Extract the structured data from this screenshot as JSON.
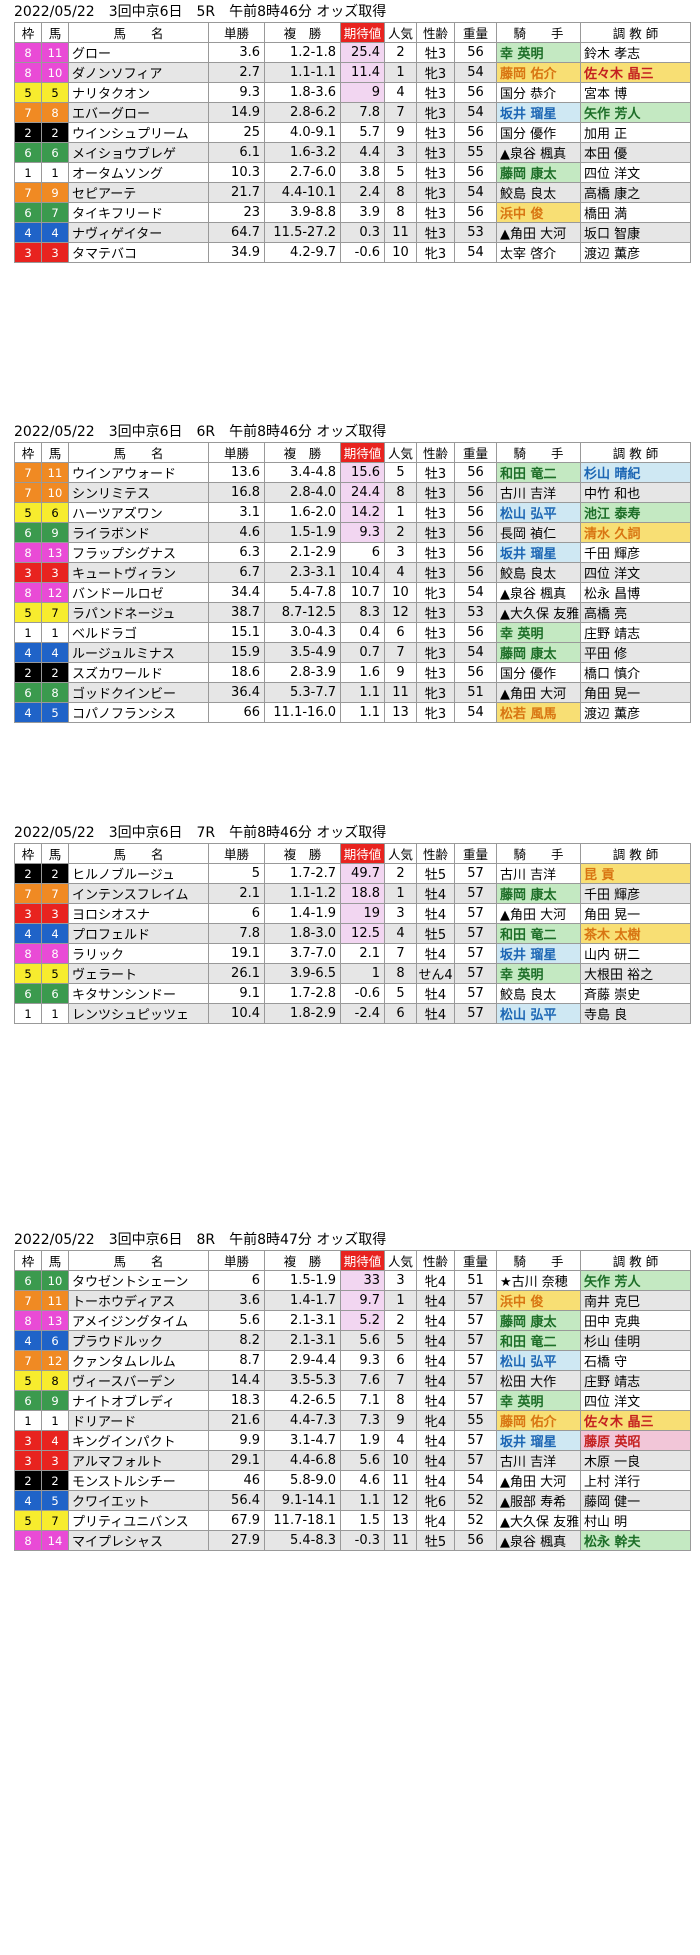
{
  "headers": {
    "waku": "枠",
    "uma": "馬",
    "name": "馬　　名",
    "tansho": "単勝",
    "fukusho": "複　勝",
    "expect": "期待値",
    "ninki": "人気",
    "seirei": "性齢",
    "juryo": "重量",
    "jockey": "騎　　手",
    "trainer": "調 教 師"
  },
  "races": [
    {
      "title": "2022/05/22　3回中京6日　5R　午前8時46分 オッズ取得",
      "rows": [
        [
          "8",
          "11",
          "グロー",
          "3.6",
          "1.2-1.8",
          "25.4",
          "2",
          "牡3",
          "56",
          "幸 英明",
          "鈴木 孝志"
        ],
        [
          "8",
          "10",
          "ダノンソフィア",
          "2.7",
          "1.1-1.1",
          "11.4",
          "1",
          "牝3",
          "54",
          "藤岡 佑介",
          "佐々木 晶三"
        ],
        [
          "5",
          "5",
          "ナリタクオン",
          "9.3",
          "1.8-3.6",
          "9",
          "4",
          "牡3",
          "56",
          "国分 恭介",
          "宮本 博"
        ],
        [
          "7",
          "8",
          "エバーグロー",
          "14.9",
          "2.8-6.2",
          "7.8",
          "7",
          "牝3",
          "54",
          "坂井 瑠星",
          "矢作 芳人"
        ],
        [
          "2",
          "2",
          "ウインシュプリーム",
          "25",
          "4.0-9.1",
          "5.7",
          "9",
          "牡3",
          "56",
          "国分 優作",
          "加用 正"
        ],
        [
          "6",
          "6",
          "メイショウブレゲ",
          "6.1",
          "1.6-3.2",
          "4.4",
          "3",
          "牡3",
          "55",
          "▲泉谷 楓真",
          "本田 優"
        ],
        [
          "1",
          "1",
          "オータムソング",
          "10.3",
          "2.7-6.0",
          "3.8",
          "5",
          "牡3",
          "56",
          "藤岡 康太",
          "四位 洋文"
        ],
        [
          "7",
          "9",
          "セピアーテ",
          "21.7",
          "4.4-10.1",
          "2.4",
          "8",
          "牝3",
          "54",
          "鮫島 良太",
          "高橋 康之"
        ],
        [
          "6",
          "7",
          "タイキフリード",
          "23",
          "3.9-8.8",
          "3.9",
          "8",
          "牡3",
          "56",
          "浜中 俊",
          "橋田 満"
        ],
        [
          "4",
          "4",
          "ナヴィゲイター",
          "64.7",
          "11.5-27.2",
          "0.3",
          "11",
          "牡3",
          "53",
          "▲角田 大河",
          "坂口 智康"
        ],
        [
          "3",
          "3",
          "タマテバコ",
          "34.9",
          "4.2-9.7",
          "-0.6",
          "10",
          "牝3",
          "54",
          "太宰 啓介",
          "渡辺 薫彦"
        ]
      ]
    },
    {
      "title": "2022/05/22　3回中京6日　6R　午前8時46分 オッズ取得",
      "rows": [
        [
          "7",
          "11",
          "ウインアウォード",
          "13.6",
          "3.4-4.8",
          "15.6",
          "5",
          "牡3",
          "56",
          "和田 竜二",
          "杉山 晴紀"
        ],
        [
          "7",
          "10",
          "シンリミテス",
          "16.8",
          "2.8-4.0",
          "24.4",
          "8",
          "牡3",
          "56",
          "古川 吉洋",
          "中竹 和也"
        ],
        [
          "5",
          "6",
          "ハーツアズワン",
          "3.1",
          "1.6-2.0",
          "14.2",
          "1",
          "牡3",
          "56",
          "松山 弘平",
          "池江 泰寿"
        ],
        [
          "6",
          "9",
          "ライラボンド",
          "4.6",
          "1.5-1.9",
          "9.3",
          "2",
          "牡3",
          "56",
          "長岡 禎仁",
          "清水 久詞"
        ],
        [
          "8",
          "13",
          "フラップシグナス",
          "6.3",
          "2.1-2.9",
          "6",
          "3",
          "牡3",
          "56",
          "坂井 瑠星",
          "千田 輝彦"
        ],
        [
          "3",
          "3",
          "キュートヴィラン",
          "6.7",
          "2.3-3.1",
          "10.4",
          "4",
          "牡3",
          "56",
          "鮫島 良太",
          "四位 洋文"
        ],
        [
          "8",
          "12",
          "バンドールロゼ",
          "34.4",
          "5.4-7.8",
          "10.7",
          "10",
          "牝3",
          "54",
          "▲泉谷 楓真",
          "松永 昌博"
        ],
        [
          "5",
          "7",
          "ラパンドネージュ",
          "38.7",
          "8.7-12.5",
          "8.3",
          "12",
          "牡3",
          "53",
          "▲大久保 友雅",
          "高橋 亮"
        ],
        [
          "1",
          "1",
          "ベルドラゴ",
          "15.1",
          "3.0-4.3",
          "0.4",
          "6",
          "牡3",
          "56",
          "幸 英明",
          "庄野 靖志"
        ],
        [
          "4",
          "4",
          "ルージュルミナス",
          "15.9",
          "3.5-4.9",
          "0.7",
          "7",
          "牝3",
          "54",
          "藤岡 康太",
          "平田 修"
        ],
        [
          "2",
          "2",
          "スズカワールド",
          "18.6",
          "2.8-3.9",
          "1.6",
          "9",
          "牡3",
          "56",
          "国分 優作",
          "橋口 慎介"
        ],
        [
          "6",
          "8",
          "ゴッドクインビー",
          "36.4",
          "5.3-7.7",
          "1.1",
          "11",
          "牝3",
          "51",
          "▲角田 大河",
          "角田 晃一"
        ],
        [
          "4",
          "5",
          "コパノフランシス",
          "66",
          "11.1-16.0",
          "1.1",
          "13",
          "牝3",
          "54",
          "松若 風馬",
          "渡辺 薫彦"
        ]
      ]
    },
    {
      "title": "2022/05/22　3回中京6日　7R　午前8時46分 オッズ取得",
      "rows": [
        [
          "2",
          "2",
          "ヒルノブルージュ",
          "5",
          "1.7-2.7",
          "49.7",
          "2",
          "牡5",
          "57",
          "古川 吉洋",
          "昆 貢"
        ],
        [
          "7",
          "7",
          "インテンスフレイム",
          "2.1",
          "1.1-1.2",
          "18.8",
          "1",
          "牡4",
          "57",
          "藤岡 康太",
          "千田 輝彦"
        ],
        [
          "3",
          "3",
          "ヨロシオスナ",
          "6",
          "1.4-1.9",
          "19",
          "3",
          "牡4",
          "57",
          "▲角田 大河",
          "角田 晃一"
        ],
        [
          "4",
          "4",
          "プロフェルド",
          "7.8",
          "1.8-3.0",
          "12.5",
          "4",
          "牡5",
          "57",
          "和田 竜二",
          "茶木 太樹"
        ],
        [
          "8",
          "8",
          "ラリック",
          "19.1",
          "3.7-7.0",
          "2.1",
          "7",
          "牡4",
          "57",
          "坂井 瑠星",
          "山内 研二"
        ],
        [
          "5",
          "5",
          "ヴェラート",
          "26.1",
          "3.9-6.5",
          "1",
          "8",
          "せん4",
          "57",
          "幸 英明",
          "大根田 裕之"
        ],
        [
          "6",
          "6",
          "キタサンシンドー",
          "9.1",
          "1.7-2.8",
          "-0.6",
          "5",
          "牡4",
          "57",
          "鮫島 良太",
          "斉藤 崇史"
        ],
        [
          "1",
          "1",
          "レンツシュピッツェ",
          "10.4",
          "1.8-2.9",
          "-2.4",
          "6",
          "牡4",
          "57",
          "松山 弘平",
          "寺島 良"
        ]
      ]
    },
    {
      "title": "2022/05/22　3回中京6日　8R　午前8時47分 オッズ取得",
      "rows": [
        [
          "6",
          "10",
          "タウゼントシェーン",
          "6",
          "1.5-1.9",
          "33",
          "3",
          "牝4",
          "51",
          "★古川 奈穂",
          "矢作 芳人"
        ],
        [
          "7",
          "11",
          "トーホウディアス",
          "3.6",
          "1.4-1.7",
          "9.7",
          "1",
          "牡4",
          "57",
          "浜中 俊",
          "南井 克巳"
        ],
        [
          "8",
          "13",
          "アメイジングタイム",
          "5.6",
          "2.1-3.1",
          "5.2",
          "2",
          "牡4",
          "57",
          "藤岡 康太",
          "田中 克典"
        ],
        [
          "4",
          "6",
          "プラウドルック",
          "8.2",
          "2.1-3.1",
          "5.6",
          "5",
          "牡4",
          "57",
          "和田 竜二",
          "杉山 佳明"
        ],
        [
          "7",
          "12",
          "クァンタムレルム",
          "8.7",
          "2.9-4.4",
          "9.3",
          "6",
          "牡4",
          "57",
          "松山 弘平",
          "石橋 守"
        ],
        [
          "5",
          "8",
          "ヴィースバーデン",
          "14.4",
          "3.5-5.3",
          "7.6",
          "7",
          "牡4",
          "57",
          "松田 大作",
          "庄野 靖志"
        ],
        [
          "6",
          "9",
          "ナイトオブレディ",
          "18.3",
          "4.2-6.5",
          "7.1",
          "8",
          "牡4",
          "57",
          "幸 英明",
          "四位 洋文"
        ],
        [
          "1",
          "1",
          "ドリアード",
          "21.6",
          "4.4-7.3",
          "7.3",
          "9",
          "牝4",
          "55",
          "藤岡 佑介",
          "佐々木 晶三"
        ],
        [
          "3",
          "4",
          "キングインパクト",
          "9.9",
          "3.1-4.7",
          "1.9",
          "4",
          "牡4",
          "57",
          "坂井 瑠星",
          "藤原 英昭"
        ],
        [
          "3",
          "3",
          "アルマフォルト",
          "29.1",
          "4.4-6.8",
          "5.6",
          "10",
          "牡4",
          "57",
          "古川 吉洋",
          "木原 一良"
        ],
        [
          "2",
          "2",
          "モンストルシチー",
          "46",
          "5.8-9.0",
          "4.6",
          "11",
          "牡4",
          "54",
          "▲角田 大河",
          "上村 洋行"
        ],
        [
          "4",
          "5",
          "クワイエット",
          "56.4",
          "9.1-14.1",
          "1.1",
          "12",
          "牝6",
          "52",
          "▲服部 寿希",
          "藤岡 健一"
        ],
        [
          "5",
          "7",
          "プリティユニバンス",
          "67.9",
          "11.7-18.1",
          "1.5",
          "13",
          "牝4",
          "52",
          "▲大久保 友雅",
          "村山 明"
        ],
        [
          "8",
          "14",
          "マイプレシャス",
          "27.9",
          "5.4-8.3",
          "-0.3",
          "11",
          "牡5",
          "56",
          "▲泉谷 楓真",
          "松永 幹夫"
        ]
      ]
    }
  ]
}
